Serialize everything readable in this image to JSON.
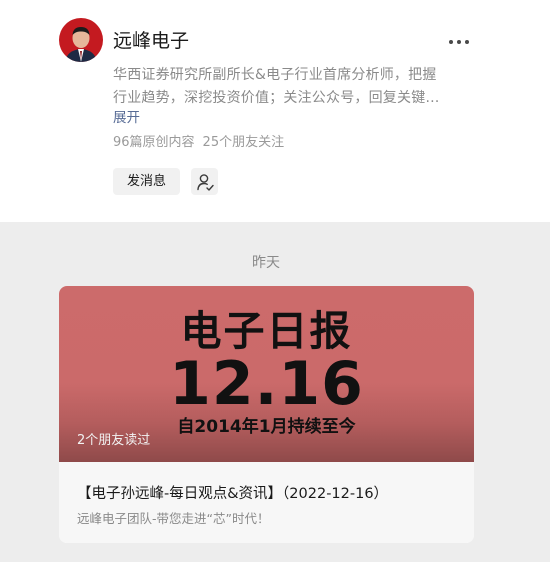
{
  "profile": {
    "name": "远峰电子",
    "description_lines": [
      "华西证券研究所副所长&电子行业首席分析师，把握",
      "行业趋势，深挖投资价值；关注公众号，回复关键…"
    ],
    "expand_label": "展开",
    "articles_stat": "96篇原创内容",
    "friends_stat": "25个朋友关注",
    "send_message_label": "发消息",
    "more_icon": "ellipsis-icon",
    "follow_icon": "person-follow-icon"
  },
  "feed": {
    "date_label": "昨天",
    "articles": [
      {
        "cover": {
          "title": "电子日报",
          "date": "12.16",
          "subtitle": "自2014年1月持续至今",
          "background_color": "#cc6b6b"
        },
        "readers": "2个朋友读过",
        "title": "【电子孙远峰-每日观点&资讯】（2022-12-16）",
        "digest": "远峰电子团队-带您走进“芯”时代！"
      }
    ]
  },
  "colors": {
    "link": "#576b95",
    "background": "#ededed",
    "secondary_text": "#8a8a8a"
  }
}
